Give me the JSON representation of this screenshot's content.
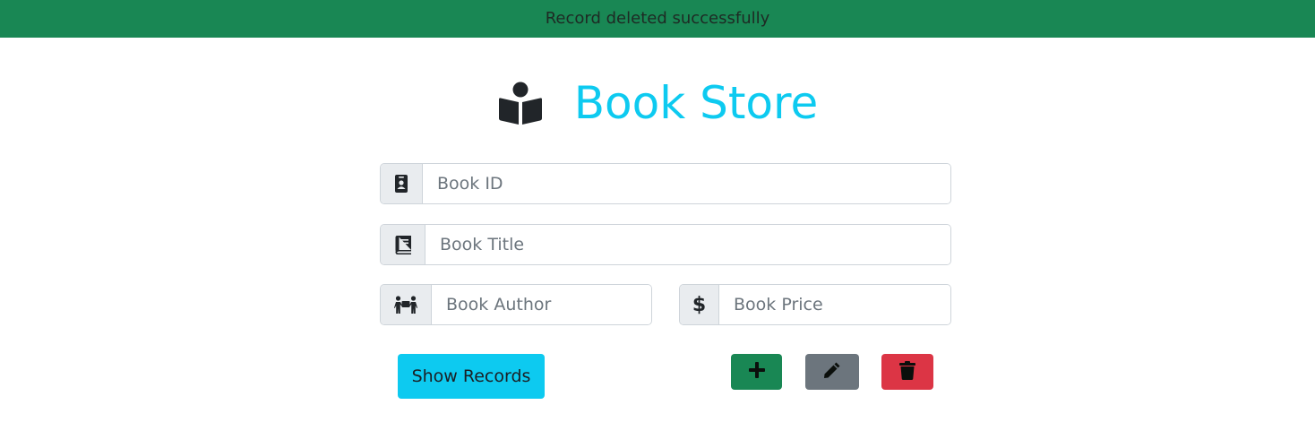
{
  "alert": {
    "message": "Record deleted successfully",
    "color": "#198754"
  },
  "header": {
    "icon": "book-reader-icon",
    "title": "Book Store",
    "title_color": "#0dcaf0"
  },
  "form": {
    "book_id": {
      "icon": "id-badge-icon",
      "placeholder": "Book ID",
      "value": ""
    },
    "book_title": {
      "icon": "book-icon",
      "placeholder": "Book Title",
      "value": ""
    },
    "book_author": {
      "icon": "people-carry-icon",
      "placeholder": "Book Author",
      "value": ""
    },
    "book_price": {
      "icon": "dollar-sign-icon",
      "symbol": "$",
      "placeholder": "Book Price",
      "value": ""
    }
  },
  "actions": {
    "show_records_label": "Show Records",
    "add_icon": "plus-icon",
    "edit_icon": "pencil-icon",
    "delete_icon": "trash-icon",
    "colors": {
      "show": "#0dcaf0",
      "add": "#198754",
      "edit": "#6c757d",
      "delete": "#dc3545"
    }
  }
}
